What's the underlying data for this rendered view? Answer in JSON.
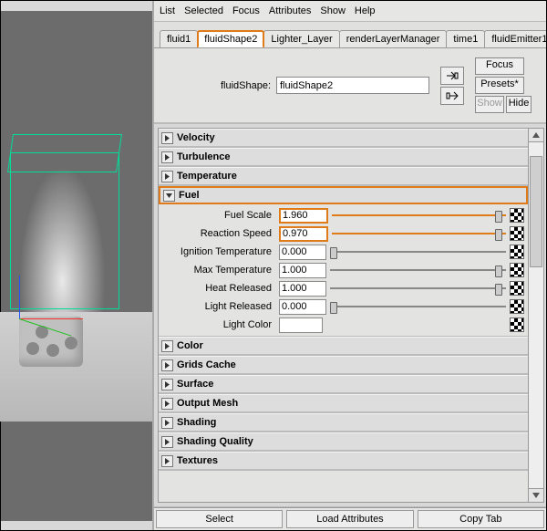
{
  "menu": [
    "List",
    "Selected",
    "Focus",
    "Attributes",
    "Show",
    "Help"
  ],
  "tabs": [
    "fluid1",
    "fluidShape2",
    "Lighter_Layer",
    "renderLayerManager",
    "time1",
    "fluidEmitter1"
  ],
  "namebar": {
    "typeLabel": "fluidShape:",
    "name": "fluidShape2",
    "focus": "Focus",
    "presets": "Presets*",
    "show": "Show",
    "hide": "Hide"
  },
  "sections": [
    "Velocity",
    "Turbulence",
    "Temperature",
    "Color",
    "Grids Cache",
    "Surface",
    "Output Mesh",
    "Shading",
    "Shading Quality",
    "Textures"
  ],
  "fuel": {
    "title": "Fuel",
    "rows": [
      {
        "label": "Fuel Scale",
        "value": "1.960"
      },
      {
        "label": "Reaction Speed",
        "value": "0.970"
      },
      {
        "label": "Ignition Temperature",
        "value": "0.000"
      },
      {
        "label": "Max Temperature",
        "value": "1.000"
      },
      {
        "label": "Heat Released",
        "value": "1.000"
      },
      {
        "label": "Light Released",
        "value": "0.000"
      },
      {
        "label": "Light Color",
        "value": ""
      }
    ]
  },
  "bottom": [
    "Select",
    "Load Attributes",
    "Copy Tab"
  ],
  "highlight_color": "#e07b1a"
}
